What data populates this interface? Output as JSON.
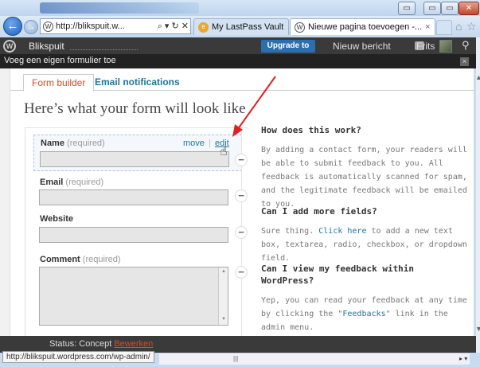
{
  "browser": {
    "address_url": "http://blikspuit.w...",
    "address_tools": "⌕ ▾ ↻ ✕",
    "tabs": [
      {
        "label": "My LastPass Vault"
      },
      {
        "label": "Nieuwe pagina toevoegen -...",
        "close": "×"
      }
    ],
    "window_buttons": {
      "min": "▭",
      "max": "▭",
      "close": "✕"
    },
    "status_url": "http://blikspuit.wordpress.com/wp-admin/"
  },
  "adminbar": {
    "site_name": "Blikspuit",
    "upgrade_label": "Upgrade to Pro",
    "new_post_label": "Nieuw bericht",
    "user_label": "Frits"
  },
  "modal": {
    "title": "Voeg een eigen formulier toe",
    "close": "×"
  },
  "tabs": {
    "form_builder": "Form builder",
    "email_notifications": "Email notifications"
  },
  "heading": "Here’s what your form will look like",
  "form": {
    "required_text": "(required)",
    "fields": [
      {
        "label": "Name",
        "required": true,
        "type": "text"
      },
      {
        "label": "Email",
        "required": true,
        "type": "text"
      },
      {
        "label": "Website",
        "required": false,
        "type": "text"
      },
      {
        "label": "Comment",
        "required": true,
        "type": "textarea"
      }
    ],
    "move_label": "move",
    "sep": "|",
    "edit_label": "edit",
    "remove_glyph": "−"
  },
  "help": {
    "q1": "How does this work?",
    "a1": "By adding a contact form, your readers will be able to submit feedback to you. All feedback is automatically scanned for spam, and the legitimate feedback will be emailed to you.",
    "q2": "Can I add more fields?",
    "a2_pre": "Sure thing.",
    "a2_link": "Click here",
    "a2_post": "to add a new text box, textarea, radio, checkbox, or dropdown field.",
    "q3": "Can I view my feedback within WordPress?",
    "a3_pre": "Yep, you can read your feedback at any time by clicking the \"",
    "a3_link": "Feedbacks",
    "a3_post": "\" link in the admin menu."
  },
  "status": {
    "label": "Status: Concept",
    "link": "Bewerken"
  },
  "colors": {
    "accent_link": "#21759b",
    "active_tab": "#d54e21",
    "annotation_arrow": "#e02020"
  }
}
